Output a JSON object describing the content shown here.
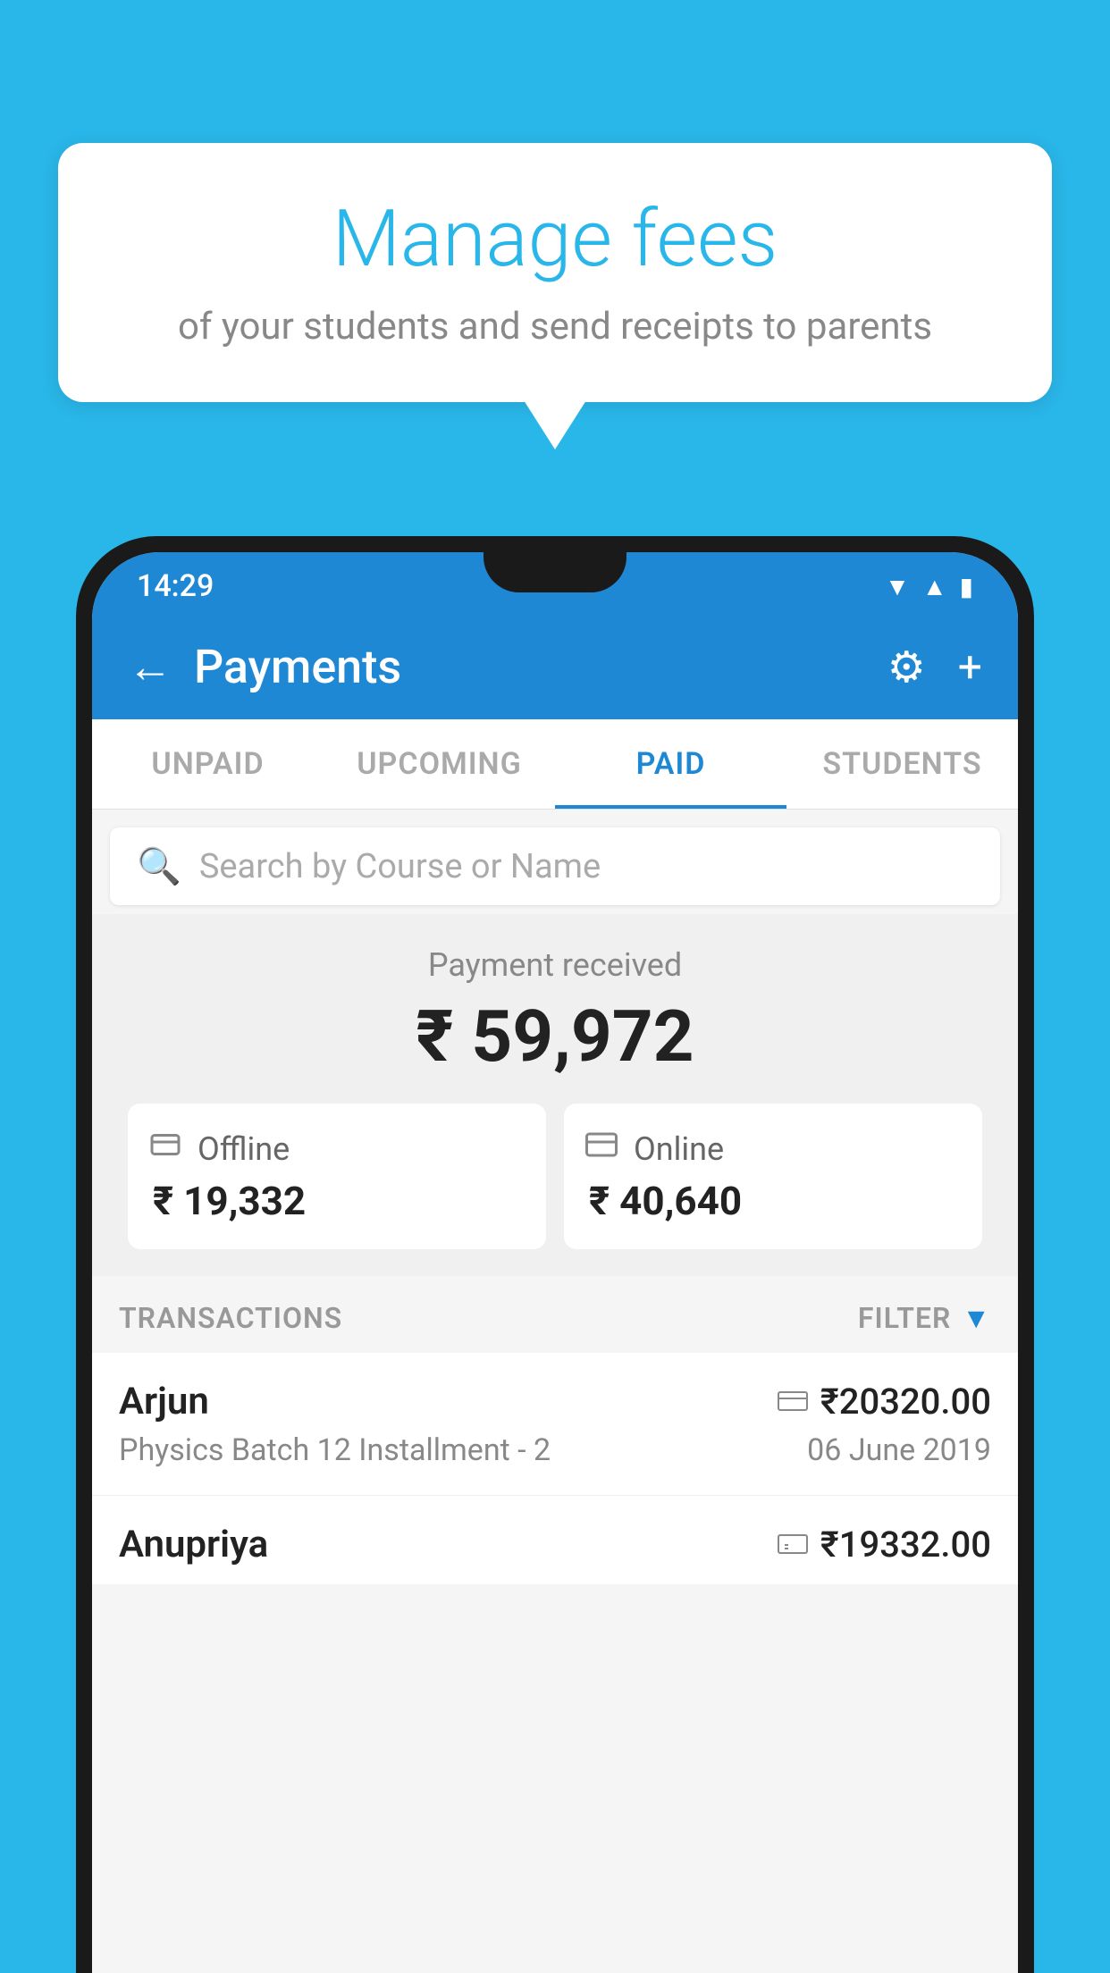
{
  "background_color": "#29b6e8",
  "bubble": {
    "title": "Manage fees",
    "subtitle": "of your students and send receipts to parents"
  },
  "status_bar": {
    "time": "14:29",
    "icons": [
      "wifi",
      "signal",
      "battery"
    ]
  },
  "app_bar": {
    "title": "Payments",
    "back_label": "←",
    "settings_label": "⚙",
    "add_label": "+"
  },
  "tabs": [
    {
      "label": "UNPAID",
      "active": false
    },
    {
      "label": "UPCOMING",
      "active": false
    },
    {
      "label": "PAID",
      "active": true
    },
    {
      "label": "STUDENTS",
      "active": false
    }
  ],
  "search": {
    "placeholder": "Search by Course or Name"
  },
  "payment_summary": {
    "label": "Payment received",
    "amount": "₹ 59,972",
    "offline": {
      "type": "Offline",
      "amount": "₹ 19,332"
    },
    "online": {
      "type": "Online",
      "amount": "₹ 40,640"
    }
  },
  "transactions": {
    "header_label": "TRANSACTIONS",
    "filter_label": "FILTER",
    "rows": [
      {
        "name": "Arjun",
        "course": "Physics Batch 12 Installment - 2",
        "amount": "₹20320.00",
        "date": "06 June 2019",
        "payment_type": "card"
      },
      {
        "name": "Anupriya",
        "amount": "₹19332.00",
        "payment_type": "offline"
      }
    ]
  }
}
